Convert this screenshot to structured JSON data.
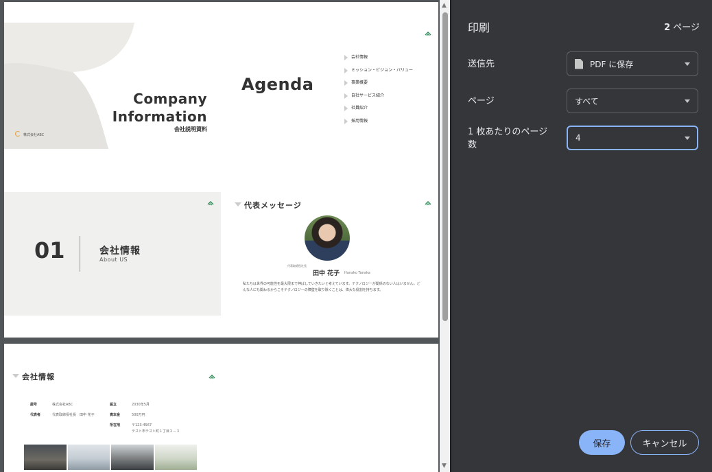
{
  "preview": {
    "cover": {
      "title_line1": "Company",
      "title_line2": "Information",
      "subtitle": "会社説明資料",
      "company": "株式会社ABC"
    },
    "agenda": {
      "title": "Agenda",
      "items": [
        "会社情報",
        "ミッション・ビジョン・バリュー",
        "事業概要",
        "自社サービス紹介",
        "社員紹介",
        "採用情報"
      ]
    },
    "section": {
      "number": "01",
      "title": "会社情報",
      "subtitle": "About US"
    },
    "message": {
      "heading": "代表メッセージ",
      "role": "代表取締役社長",
      "name": "田中 花子",
      "name_en": "Hanako Tanaka",
      "body": "私たちは世界の可能性を最大限まで伸ばしていきたいと考えています。テクノロジーが関係のない人はいません。どんな人にも関わるからこそテクノロジーの障壁を取り除くことは、偉大な役割を持ちます。"
    },
    "company_info": {
      "heading": "会社情報",
      "rows": [
        {
          "label": "屋号",
          "value": "株式会社ABC"
        },
        {
          "label": "代表者",
          "value": "代表取締役社長　田中 花子"
        },
        {
          "label": "設立",
          "value": "2030年5月"
        },
        {
          "label": "資本金",
          "value": "500万円"
        },
        {
          "label": "所在地",
          "value": "〒123-4567"
        },
        {
          "label": "",
          "value": "テスト市テスト町１丁目２－３"
        }
      ]
    }
  },
  "panel": {
    "title": "印刷",
    "page_count_number": "2",
    "page_count_unit": "ページ",
    "destination": {
      "label": "送信先",
      "value": "PDF に保存"
    },
    "pages": {
      "label": "ページ",
      "value": "すべて"
    },
    "pages_per_sheet": {
      "label_line1": "1 枚あたりのページ",
      "label_line2": "数",
      "value": "4"
    },
    "save_label": "保存",
    "cancel_label": "キャンセル"
  },
  "colors": {
    "panel_bg": "#35363a",
    "accent": "#8ab4f8",
    "logo_green": "#2e8b57"
  }
}
